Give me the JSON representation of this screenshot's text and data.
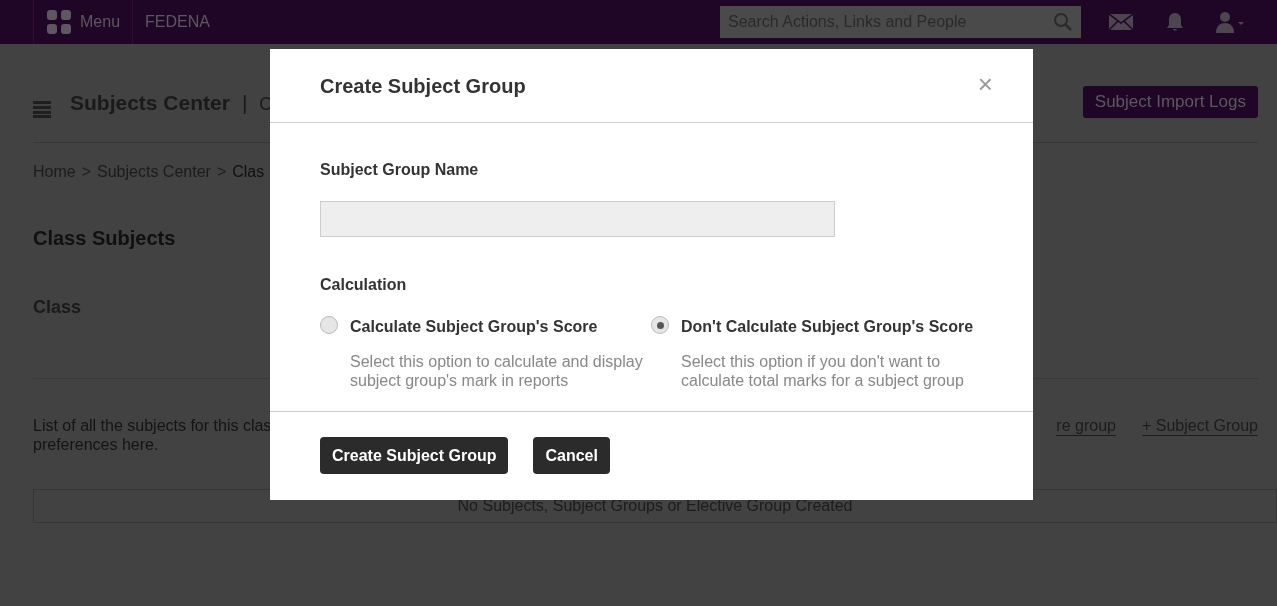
{
  "top_bar": {
    "menu_label": "Menu",
    "brand": "FEDENA",
    "search": {
      "placeholder": "Search Actions, Links and People"
    }
  },
  "page": {
    "title": "Subjects Center",
    "title_separator": "|",
    "subtitle": "C",
    "breadcrumb_separator": ">",
    "import_button": "Subject Import Logs",
    "breadcrumb": [
      {
        "label": "Home",
        "current": false
      },
      {
        "label": "Subjects Center",
        "current": false
      },
      {
        "label": "Clas",
        "current": true
      }
    ],
    "section_title": "Class Subjects",
    "class_label": "Class",
    "description": [
      "List of all the subjects for this clas",
      "preferences here."
    ],
    "links": [
      "re group",
      "+ Subject Group"
    ],
    "table": {
      "empty_message": "No Subjects, Subject Groups or Elective Group Created"
    }
  },
  "dialog": {
    "title": "Create Subject Group",
    "close": "×",
    "name_field": {
      "label": "Subject Group Name"
    },
    "calculation_label": "Calculation",
    "options": [
      {
        "label": "Calculate Subject Group's Score",
        "description": "Select this option to calculate and display subject group's mark in reports",
        "selected": false
      },
      {
        "label": "Don't Calculate Subject Group's Score",
        "description": "Select this option if you don't want to calculate total marks for a subject group",
        "selected": true
      }
    ],
    "buttons": [
      "Create Subject Group",
      "Cancel"
    ]
  }
}
